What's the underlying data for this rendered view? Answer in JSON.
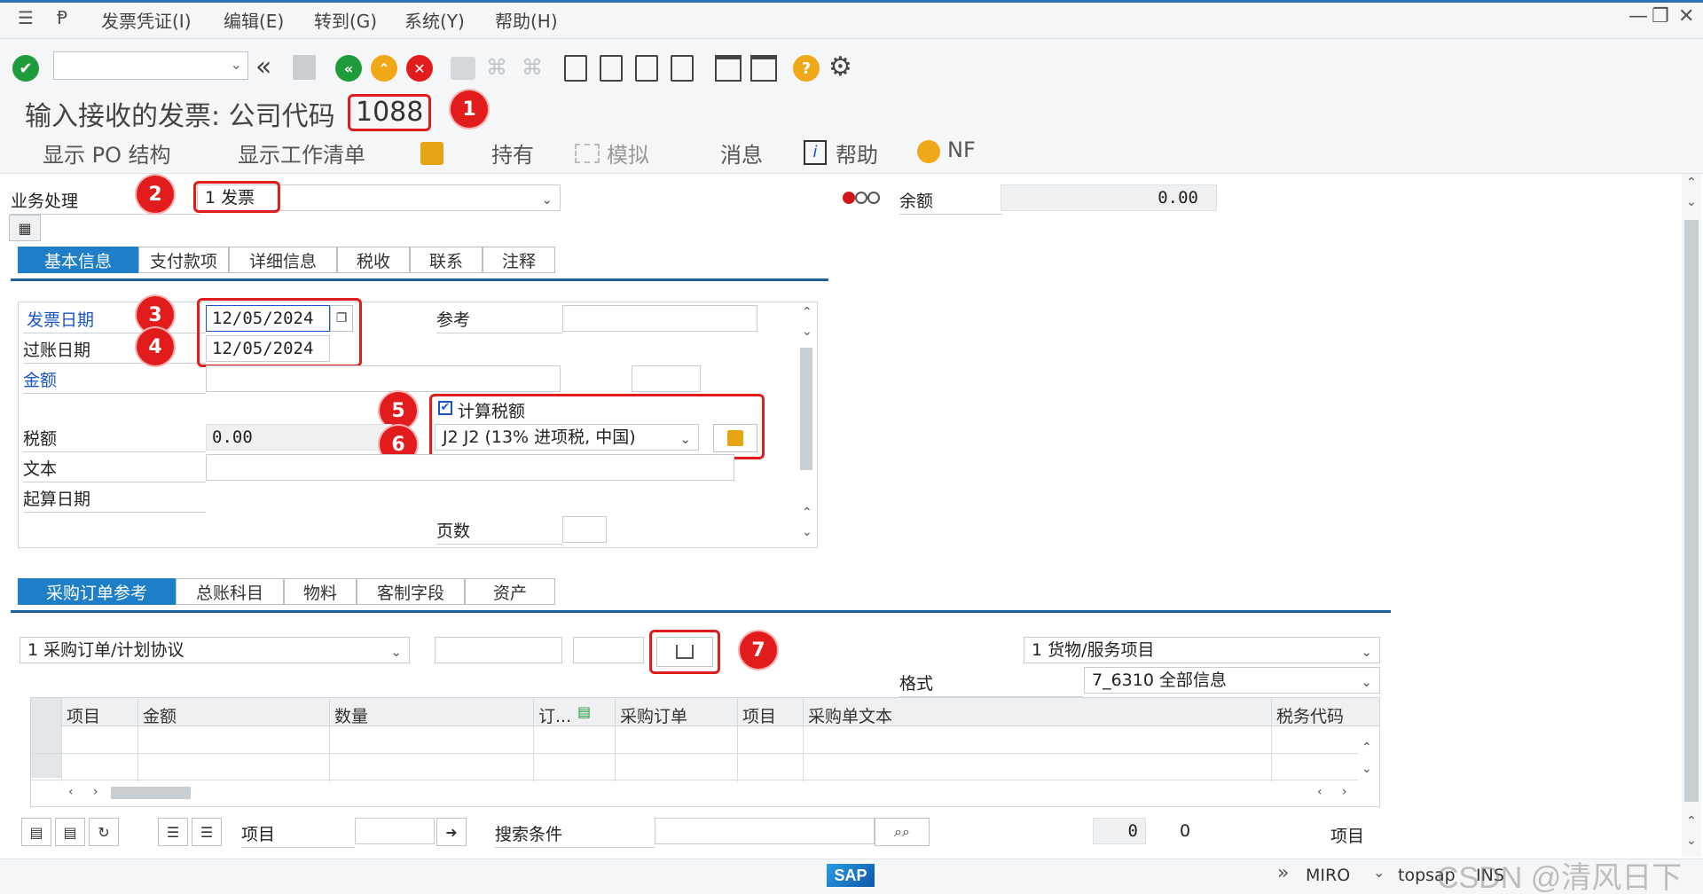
{
  "menu": {
    "items": [
      "发票凭证(I)",
      "编辑(E)",
      "转到(G)",
      "系统(Y)",
      "帮助(H)"
    ]
  },
  "title": {
    "text": "输入接收的发票: 公司代码",
    "company_code": "1088"
  },
  "app_toolbar": {
    "show_po_structure": "显示 PO 结构",
    "show_worklist": "显示工作清单",
    "hold": "持有",
    "simulate": "模拟",
    "messages": "消息",
    "help": "帮助",
    "nf": "NF"
  },
  "header": {
    "transaction_label": "业务处理",
    "transaction_value": "1 发票",
    "balance_label": "余额",
    "balance_value": "0.00"
  },
  "tabs_top": [
    "基本信息",
    "支付款项",
    "详细信息",
    "税收",
    "联系",
    "注释"
  ],
  "basic": {
    "invoice_date_label": "发票日期",
    "invoice_date": "12/05/2024",
    "posting_date_label": "过账日期",
    "posting_date": "12/05/2024",
    "amount_label": "金额",
    "reference_label": "参考",
    "calc_tax_label": "计算税额",
    "tax_code": "J2 J2 (13% 进项税, 中国)",
    "tax_amount_label": "税额",
    "tax_amount": "0.00",
    "text_label": "文本",
    "baseline_date_label": "起算日期",
    "pages_label": "页数"
  },
  "badges": [
    "1",
    "2",
    "3",
    "4",
    "5",
    "6",
    "7"
  ],
  "tabs_bottom": [
    "采购订单参考",
    "总账科目",
    "物料",
    "客制字段",
    "资产"
  ],
  "po_ref": {
    "ref_type": "1 采购订单/计划协议",
    "item_type": "1 货物/服务项目",
    "format_label": "格式",
    "format_value": "7_6310 全部信息"
  },
  "grid": {
    "columns": [
      "项目",
      "金额",
      "数量",
      "订...",
      "采购订单",
      "项目",
      "采购单文本",
      "税务代码"
    ]
  },
  "bottom_bar": {
    "item_label": "项目",
    "search_label": "搜索条件",
    "count_box": "0",
    "count_text": "0",
    "items_label": "项目"
  },
  "status": {
    "logo": "SAP",
    "tcode": "MIRO",
    "system": "topsap",
    "mode": "INS",
    "watermark": "CSDN @清风日下"
  }
}
